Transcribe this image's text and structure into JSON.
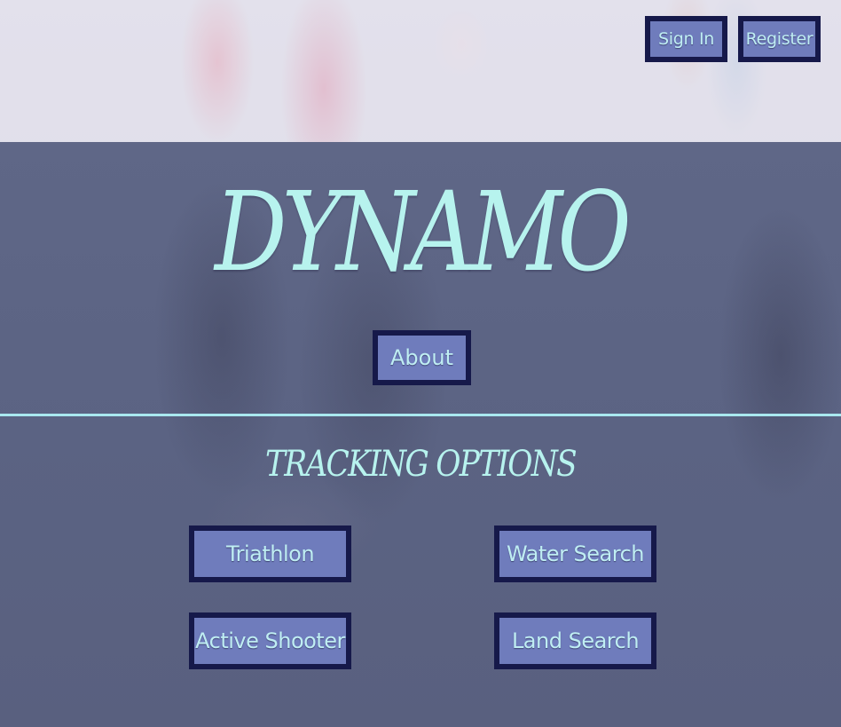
{
  "header": {
    "sign_in_label": "Sign In",
    "register_label": "Register"
  },
  "hero": {
    "title": "DYNAMO",
    "about_label": "About"
  },
  "tracking": {
    "heading": "TRACKING OPTIONS",
    "options": [
      {
        "label": "Triathlon"
      },
      {
        "label": "Water Search"
      },
      {
        "label": "Active Shooter"
      },
      {
        "label": "Land Search"
      }
    ]
  },
  "colors": {
    "accent_text": "#b7f3ee",
    "button_fill": "#6f7cbc",
    "button_border": "#16194a",
    "divider": "#a9e8ef"
  }
}
